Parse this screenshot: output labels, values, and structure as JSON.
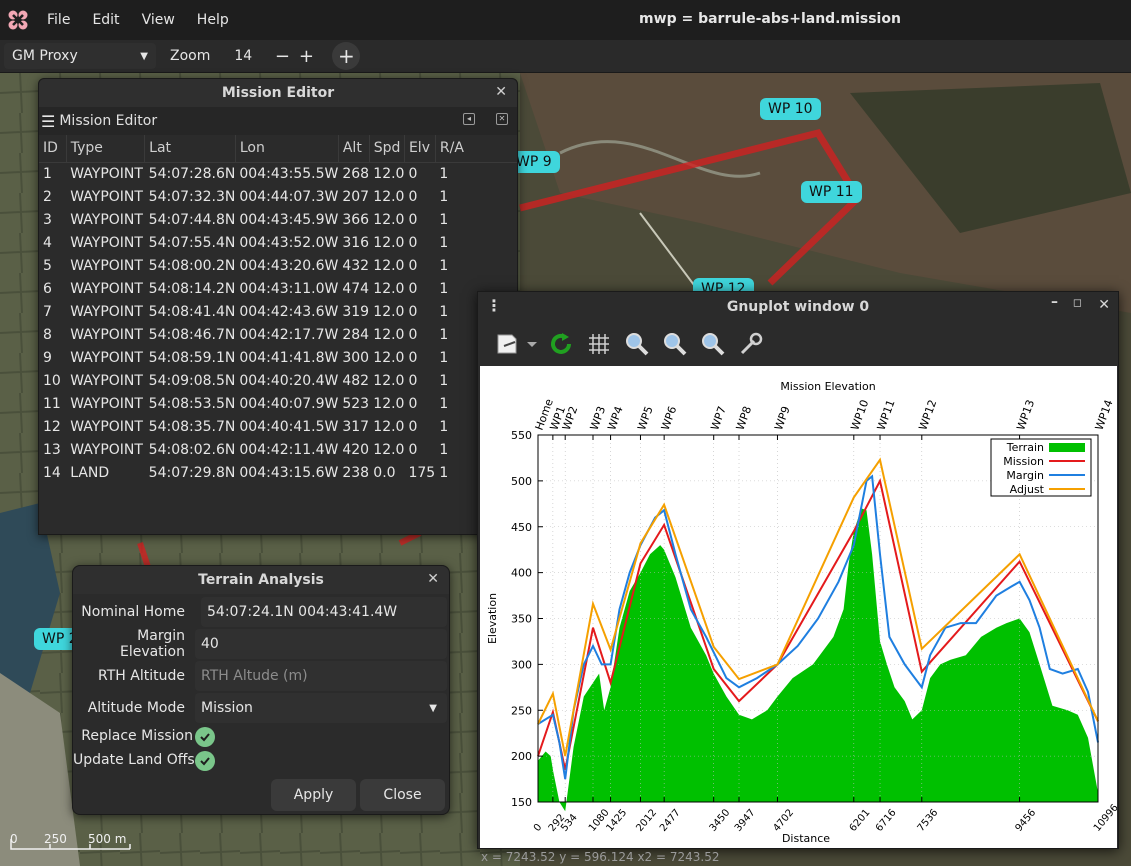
{
  "menubar": {
    "items": [
      "File",
      "Edit",
      "View",
      "Help"
    ],
    "title": "mwp = barrule-abs+land.mission"
  },
  "toolbar": {
    "map_source": "GM Proxy",
    "zoom_label": "Zoom",
    "zoom_value": "14",
    "zoom_out": "−",
    "zoom_in": "+",
    "add": "+"
  },
  "map": {
    "waypoint_tags": [
      "WP 10",
      "WP 9",
      "WP 11",
      "WP 12",
      "WP 2"
    ],
    "scale": {
      "labels": [
        "0",
        "250",
        "500 m"
      ]
    }
  },
  "mission_editor": {
    "title": "Mission Editor",
    "subtitle": "Mission Editor",
    "columns": [
      "ID",
      "Type",
      "Lat",
      "Lon",
      "Alt",
      "Spd",
      "Elv",
      "R/A"
    ],
    "rows": [
      [
        "1",
        "WAYPOINT",
        "54:07:28.6N",
        "004:43:55.5W",
        "268",
        "12.0",
        "0",
        "1"
      ],
      [
        "2",
        "WAYPOINT",
        "54:07:32.3N",
        "004:44:07.3W",
        "207",
        "12.0",
        "0",
        "1"
      ],
      [
        "3",
        "WAYPOINT",
        "54:07:44.8N",
        "004:43:45.9W",
        "366",
        "12.0",
        "0",
        "1"
      ],
      [
        "4",
        "WAYPOINT",
        "54:07:55.4N",
        "004:43:52.0W",
        "316",
        "12.0",
        "0",
        "1"
      ],
      [
        "5",
        "WAYPOINT",
        "54:08:00.2N",
        "004:43:20.6W",
        "432",
        "12.0",
        "0",
        "1"
      ],
      [
        "6",
        "WAYPOINT",
        "54:08:14.2N",
        "004:43:11.0W",
        "474",
        "12.0",
        "0",
        "1"
      ],
      [
        "7",
        "WAYPOINT",
        "54:08:41.4N",
        "004:42:43.6W",
        "319",
        "12.0",
        "0",
        "1"
      ],
      [
        "8",
        "WAYPOINT",
        "54:08:46.7N",
        "004:42:17.7W",
        "284",
        "12.0",
        "0",
        "1"
      ],
      [
        "9",
        "WAYPOINT",
        "54:08:59.1N",
        "004:41:41.8W",
        "300",
        "12.0",
        "0",
        "1"
      ],
      [
        "10",
        "WAYPOINT",
        "54:09:08.5N",
        "004:40:20.4W",
        "482",
        "12.0",
        "0",
        "1"
      ],
      [
        "11",
        "WAYPOINT",
        "54:08:53.5N",
        "004:40:07.9W",
        "523",
        "12.0",
        "0",
        "1"
      ],
      [
        "12",
        "WAYPOINT",
        "54:08:35.7N",
        "004:40:41.5W",
        "317",
        "12.0",
        "0",
        "1"
      ],
      [
        "13",
        "WAYPOINT",
        "54:08:02.6N",
        "004:42:11.4W",
        "420",
        "12.0",
        "0",
        "1"
      ],
      [
        "14",
        "LAND",
        "54:07:29.8N",
        "004:43:15.6W",
        "238",
        "0.0",
        "175",
        "1"
      ]
    ]
  },
  "terrain_analysis": {
    "title": "Terrain Analysis",
    "nominal_home_label": "Nominal Home",
    "nominal_home_value": "54:07:24.1N 004:43:41.4W",
    "margin_label": "Margin Elevation",
    "margin_value": "40",
    "rth_label": "RTH Altitude",
    "rth_placeholder": "RTH Altude (m)",
    "mode_label": "Altitude Mode",
    "mode_value": "Mission",
    "replace_label": "Replace Mission",
    "update_label": "Update Land Offset",
    "apply_label": "Apply",
    "close_label": "Close"
  },
  "gnuplot": {
    "title": "Gnuplot window 0",
    "status": "x = 7243.52 y = 596.124 x2 = 7243.52"
  },
  "colors": {
    "terrain": "#00c000",
    "mission": "#e41a1c",
    "margin": "#1f7fe0",
    "adjust": "#f5a000",
    "wp_tag": "#3fd6dc",
    "route": "#d02020"
  },
  "chart_data": {
    "type": "line",
    "title": "Mission Elevation",
    "xlabel": "Distance",
    "ylabel": "Elevation",
    "xlim": [
      0,
      10996
    ],
    "ylim": [
      150,
      550
    ],
    "yticks": [
      150,
      200,
      250,
      300,
      350,
      400,
      450,
      500,
      550
    ],
    "xticks": [
      0,
      292,
      534,
      1080,
      1425,
      2012,
      2477,
      3450,
      3947,
      4702,
      6201,
      6716,
      7536,
      9456,
      10996
    ],
    "x2ticks": [
      {
        "label": "Home",
        "x": 0
      },
      {
        "label": "WP1",
        "x": 292
      },
      {
        "label": "WP2",
        "x": 534
      },
      {
        "label": "WP3",
        "x": 1080
      },
      {
        "label": "WP4",
        "x": 1425
      },
      {
        "label": "WP5",
        "x": 2012
      },
      {
        "label": "WP6",
        "x": 2477
      },
      {
        "label": "WP7",
        "x": 3450
      },
      {
        "label": "WP8",
        "x": 3947
      },
      {
        "label": "WP9",
        "x": 4702
      },
      {
        "label": "WP10",
        "x": 6201
      },
      {
        "label": "WP11",
        "x": 6716
      },
      {
        "label": "WP12",
        "x": 7536
      },
      {
        "label": "WP13",
        "x": 9456
      },
      {
        "label": "WP14",
        "x": 10996
      }
    ],
    "grid": true,
    "legend_position": "top-right",
    "series": [
      {
        "name": "Terrain",
        "kind": "area",
        "x": [
          0,
          150,
          250,
          292,
          420,
          534,
          700,
          900,
          1080,
          1200,
          1300,
          1425,
          1600,
          1800,
          2012,
          2200,
          2400,
          2477,
          2700,
          3000,
          3300,
          3450,
          3700,
          3947,
          4200,
          4500,
          4702,
          5000,
          5400,
          5800,
          6000,
          6100,
          6201,
          6350,
          6450,
          6560,
          6716,
          6850,
          7000,
          7200,
          7350,
          7536,
          7700,
          7900,
          8100,
          8400,
          8700,
          9000,
          9200,
          9456,
          9650,
          9850,
          10100,
          10400,
          10600,
          10800,
          10996
        ],
        "y": [
          195,
          205,
          200,
          185,
          150,
          140,
          210,
          265,
          280,
          290,
          250,
          275,
          340,
          380,
          400,
          420,
          430,
          425,
          395,
          340,
          310,
          290,
          265,
          245,
          240,
          250,
          265,
          285,
          300,
          330,
          360,
          410,
          445,
          470,
          468,
          420,
          325,
          300,
          275,
          260,
          240,
          250,
          285,
          300,
          305,
          310,
          330,
          340,
          345,
          350,
          335,
          300,
          255,
          250,
          245,
          220,
          160
        ]
      },
      {
        "name": "Mission",
        "kind": "line",
        "x": [
          0,
          292,
          534,
          1080,
          1425,
          2012,
          2477,
          3450,
          3947,
          4702,
          6201,
          6716,
          7536,
          9456,
          10996
        ],
        "y": [
          200,
          248,
          185,
          340,
          280,
          410,
          452,
          295,
          260,
          300,
          445,
          500,
          292,
          412,
          238
        ]
      },
      {
        "name": "Margin",
        "kind": "line",
        "x": [
          0,
          292,
          420,
          534,
          700,
          900,
          1080,
          1250,
          1425,
          1600,
          1800,
          2012,
          2300,
          2477,
          2700,
          3000,
          3300,
          3700,
          3947,
          4300,
          4702,
          5100,
          5500,
          5900,
          6201,
          6450,
          6560,
          6716,
          6900,
          7200,
          7400,
          7536,
          7700,
          8000,
          8300,
          8600,
          9000,
          9300,
          9456,
          9650,
          9850,
          10050,
          10300,
          10600,
          10800,
          10996
        ],
        "y": [
          235,
          245,
          215,
          175,
          250,
          300,
          320,
          300,
          300,
          360,
          400,
          430,
          460,
          468,
          420,
          360,
          330,
          285,
          275,
          285,
          300,
          320,
          350,
          390,
          430,
          500,
          505,
          420,
          330,
          300,
          285,
          275,
          310,
          340,
          345,
          345,
          375,
          385,
          390,
          370,
          340,
          295,
          290,
          295,
          270,
          215
        ]
      },
      {
        "name": "Adjust",
        "kind": "line",
        "x": [
          0,
          292,
          534,
          1080,
          1425,
          2012,
          2477,
          3450,
          3947,
          4702,
          6201,
          6716,
          7536,
          9456,
          10996
        ],
        "y": [
          235,
          268,
          200,
          366,
          316,
          432,
          474,
          319,
          284,
          300,
          482,
          523,
          317,
          420,
          238
        ]
      }
    ]
  }
}
